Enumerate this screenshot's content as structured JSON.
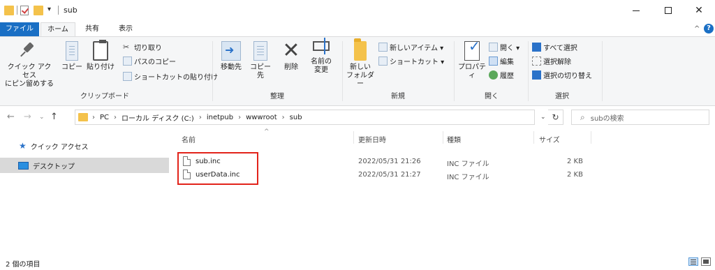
{
  "window": {
    "title": "sub",
    "qa_dropdown": "▾",
    "minimize": "",
    "maximize": "",
    "close": "✕"
  },
  "ribbon_tabs": {
    "file": "ファイル",
    "home": "ホーム",
    "share": "共有",
    "view": "表示",
    "collapse": "^",
    "help": "?"
  },
  "ribbon": {
    "clipboard": {
      "label": "クリップボード",
      "pin_line1": "クイック アクセス",
      "pin_line2": "にピン留めする",
      "copy": "コピー",
      "paste": "貼り付け",
      "cut": "切り取り",
      "copy_path": "パスのコピー",
      "paste_shortcut": "ショートカットの貼り付け"
    },
    "organize": {
      "label": "整理",
      "move_to": "移動先",
      "copy_to": "コピー先",
      "delete": "削除",
      "rename_line1": "名前の",
      "rename_line2": "変更"
    },
    "new": {
      "label": "新規",
      "new_folder_line1": "新しい",
      "new_folder_line2": "フォルダー",
      "new_item": "新しいアイテム ▾",
      "shortcut": "ショートカット ▾"
    },
    "open": {
      "label": "開く",
      "properties": "プロパティ",
      "open": "開く ▾",
      "edit": "編集",
      "history": "履歴"
    },
    "select": {
      "label": "選択",
      "select_all": "すべて選択",
      "select_none": "選択解除",
      "invert": "選択の切り替え"
    }
  },
  "navigation": {
    "back": "←",
    "forward": "→",
    "recent": "⌄",
    "up": "↑",
    "breadcrumb": [
      "PC",
      "ローカル ディスク (C:)",
      "inetpub",
      "wwwroot",
      "sub"
    ],
    "breadcrumb_sep": "›",
    "address_dropdown": "⌄",
    "refresh": "↻",
    "search_placeholder": "subの検索"
  },
  "nav_pane": {
    "quick_access": "クイック アクセス",
    "desktop": "デスクトップ"
  },
  "file_list": {
    "columns": {
      "name": "名前",
      "date": "更新日時",
      "type": "種類",
      "size": "サイズ"
    },
    "sort_indicator": "^",
    "files": [
      {
        "name": "sub.inc",
        "date": "2022/05/31 21:26",
        "type": "INC ファイル",
        "size": "2 KB"
      },
      {
        "name": "userData.inc",
        "date": "2022/05/31 21:27",
        "type": "INC ファイル",
        "size": "2 KB"
      }
    ]
  },
  "status": {
    "item_count": "2 個の項目"
  },
  "colors": {
    "accent": "#1a6fc4",
    "highlight_box": "#e2231a",
    "selected_nav": "#d9d9d9"
  }
}
